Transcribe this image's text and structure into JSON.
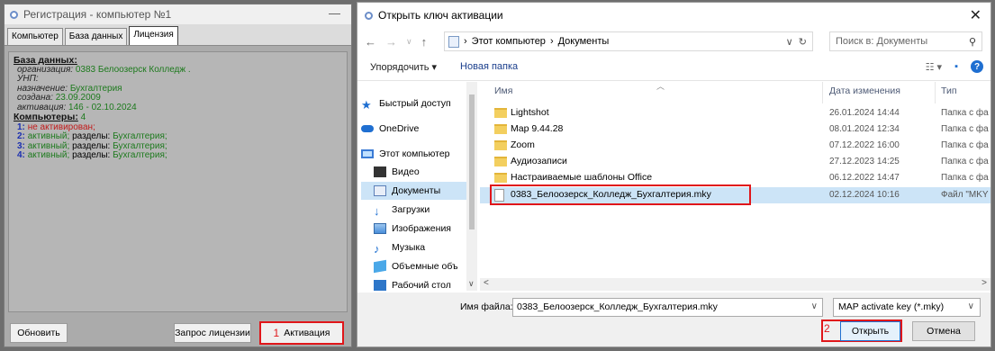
{
  "registration": {
    "title": "Регистрация - компьютер №1",
    "tabs": [
      "Компьютер",
      "База данных",
      "Лицензия"
    ],
    "database_header": "База данных:",
    "org_label": "организация:",
    "org_value": "0383 Белоозерск Колледж .",
    "unp_label": "УНП:",
    "purpose_label": "назначение:",
    "purpose_value": "Бухгалтерия",
    "created_label": "создана:",
    "created_value": "23.09.2009",
    "activation_label": "активация:",
    "activation_value": "146 - 02.10.2024",
    "computers_header": "Компьютеры:",
    "computers_count": "4",
    "computers": [
      {
        "num": "1:",
        "status": "не активирован;",
        "sections_label": "",
        "sections": ""
      },
      {
        "num": "2:",
        "status": "активный;",
        "sections_label": "разделы:",
        "sections": "Бухгалтерия;"
      },
      {
        "num": "3:",
        "status": "активный;",
        "sections_label": "разделы:",
        "sections": "Бухгалтерия;"
      },
      {
        "num": "4:",
        "status": "активный;",
        "sections_label": "разделы:",
        "sections": "Бухгалтерия;"
      }
    ],
    "buttons": {
      "refresh": "Обновить",
      "request": "Запрос лицензии",
      "activate_marker": "1",
      "activate": "Активация"
    }
  },
  "dialog": {
    "title": "Открыть ключ активации",
    "breadcrumb": [
      "Этот компьютер",
      "Документы"
    ],
    "search_placeholder": "Поиск в: Документы",
    "toolbar": {
      "organize": "Упорядочить ▾",
      "new_folder": "Новая папка"
    },
    "nav": [
      "Быстрый доступ",
      "OneDrive",
      "Этот компьютер",
      "Видео",
      "Документы",
      "Загрузки",
      "Изображения",
      "Музыка",
      "Объемные объ",
      "Рабочий стол"
    ],
    "columns": {
      "name": "Имя",
      "date": "Дата изменения",
      "type": "Тип"
    },
    "files": [
      {
        "name": "Lightshot",
        "date": "26.01.2024 14:44",
        "type": "Папка с фа"
      },
      {
        "name": "Map 9.44.28",
        "date": "08.01.2024 12:34",
        "type": "Папка с фа"
      },
      {
        "name": "Zoom",
        "date": "07.12.2022 16:00",
        "type": "Папка с фа"
      },
      {
        "name": "Аудиозаписи",
        "date": "27.12.2023 14:25",
        "type": "Папка с фа"
      },
      {
        "name": "Настраиваемые шаблоны Office",
        "date": "06.12.2022 14:47",
        "type": "Папка с фа"
      },
      {
        "name": "0383_Белоозерск_Колледж_Бухгалтерия.mky",
        "date": "02.12.2024 10:16",
        "type": "Файл \"MKY"
      }
    ],
    "filename_label": "Имя файла:",
    "filename_value": "0383_Белоозерск_Колледж_Бухгалтерия.mky",
    "filetype": "MAP activate key (*.mky)",
    "open_marker": "2",
    "open": "Открыть",
    "cancel": "Отмена"
  }
}
